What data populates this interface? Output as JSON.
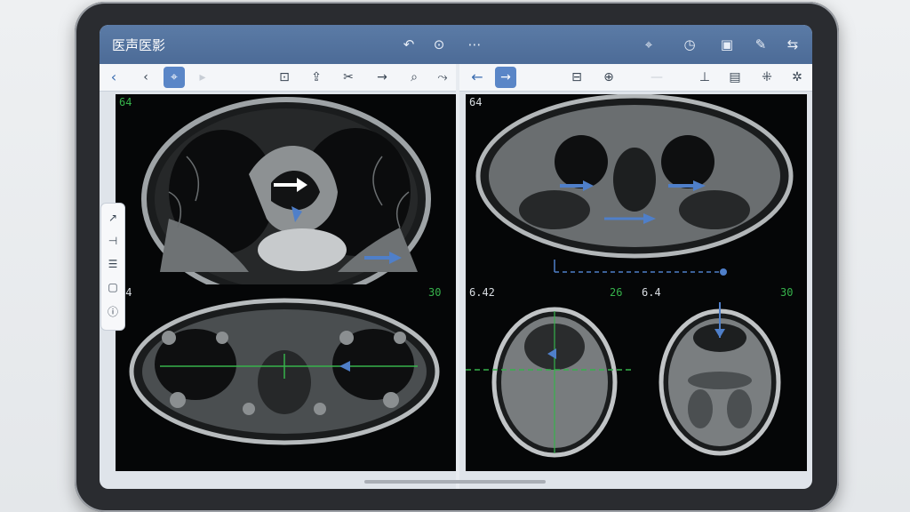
{
  "app": {
    "title": "医声医影"
  },
  "titlebar_icons": [
    "undo-icon",
    "history-icon",
    "more-icon",
    "location-pin-icon",
    "download-icon",
    "layout-icon",
    "edit-icon",
    "collapse-icon"
  ],
  "left_toolbar": {
    "icons": [
      "back-chevron-icon",
      "previous-icon",
      "crosshair-icon",
      "disabled-icon",
      "ruler-icon",
      "export-icon",
      "cut-icon",
      "arrow-right-icon",
      "magnify-icon",
      "sync-icon"
    ]
  },
  "right_toolbar": {
    "icons": [
      "back-arrow-icon",
      "arrow-active-icon",
      "image-icon",
      "zoom-icon",
      "blank-icon",
      "pin-icon",
      "panel-icon",
      "measure-icon",
      "settings-icon"
    ]
  },
  "viewports": {
    "top_left": {
      "label": "64"
    },
    "top_right": {
      "label": "64"
    },
    "bottom_left": {
      "label_left": "24",
      "label_right": "30"
    },
    "bottom_right_a": {
      "label_left": "6.42",
      "label_right": "26"
    },
    "bottom_right_b": {
      "label_left": "6.4",
      "label_right": "30"
    }
  },
  "side_tools": [
    "draw-icon",
    "ruler-vertical-icon",
    "layers-icon",
    "crop-icon",
    "info-icon"
  ],
  "colors": {
    "title_bar": "#4c6b97",
    "accent": "#5a86c7",
    "annotation_green": "#36b24b",
    "annotation_blue": "#4f7fc9"
  }
}
